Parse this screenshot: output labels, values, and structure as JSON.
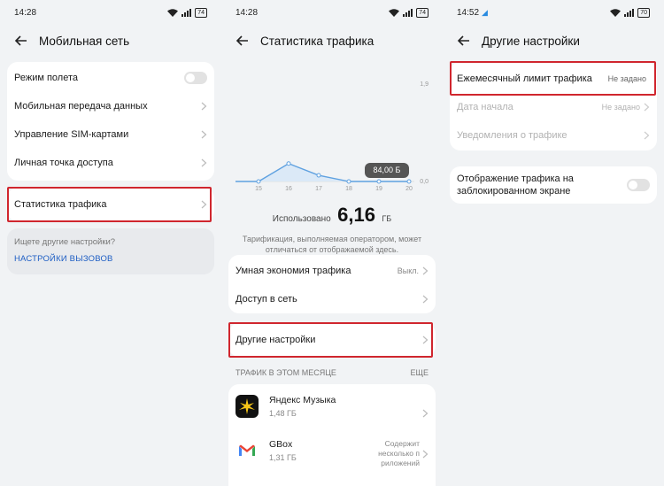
{
  "panel1": {
    "time": "14:28",
    "battery": "74",
    "title": "Мобильная сеть",
    "items": [
      {
        "label": "Режим полета"
      },
      {
        "label": "Мобильная передача данных"
      },
      {
        "label": "Управление SIM-картами"
      },
      {
        "label": "Личная точка доступа"
      }
    ],
    "traffic_stats": "Статистика трафика",
    "search_hint": "Ищете другие настройки?",
    "call_settings": "НАСТРОЙКИ ВЫЗОВОВ"
  },
  "panel2": {
    "time": "14:28",
    "battery": "74",
    "title": "Статистика трафика",
    "chart_data": {
      "type": "line",
      "x": [
        "15",
        "16",
        "17",
        "18",
        "19",
        "20"
      ],
      "values": [
        0.0,
        0.35,
        0.12,
        0.0,
        0.0,
        0.0
      ],
      "y_ticks": [
        "1,9",
        "0,0"
      ],
      "ylim": [
        0,
        1.9
      ],
      "tooltip": "84,00 Б",
      "fill_color": "#dbe9f7",
      "line_color": "#5fa1e0"
    },
    "used_label": "Использовано",
    "used_value": "6,16",
    "used_unit": "ГБ",
    "note": "Тарификация, выполняемая оператором, может отличаться от отображаемой здесь.",
    "smart_saving": "Умная экономия трафика",
    "smart_saving_value": "Выкл.",
    "network_access": "Доступ в сеть",
    "other_settings": "Другие настройки",
    "month_section": "ТРАФИК В ЭТОМ МЕСЯЦЕ",
    "more": "ЕЩЕ",
    "apps": [
      {
        "name": "Яндекс Музыка",
        "size": "1,48 ГБ",
        "note": ""
      },
      {
        "name": "GBox",
        "size": "1,31 ГБ",
        "note": "Содержит несколько п риложений"
      }
    ]
  },
  "panel3": {
    "time": "14:52",
    "time_extra": "◢",
    "battery": "70",
    "title": "Другие настройки",
    "monthly_limit": "Ежемесячный лимит трафика",
    "monthly_limit_value": "Не задано",
    "start_date": "Дата начала",
    "start_date_value": "Не задано",
    "notifications": "Уведомления о трафике",
    "lockscreen": "Отображение трафика на заблокированном экране"
  },
  "colors": {
    "highlight": "#d0262e",
    "link": "#1f5fc4",
    "chart_line": "#5fa1e0"
  }
}
